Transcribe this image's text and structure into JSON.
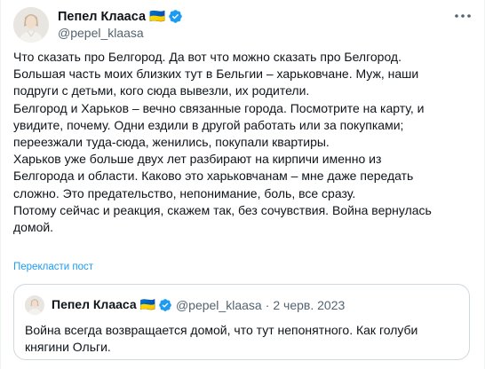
{
  "author": {
    "display_name": "Пепел Клааса 🇺🇦",
    "handle": "@pepel_klaasa",
    "verified": true,
    "avatar_icon": "profile-photo"
  },
  "tweet": {
    "lines": [
      "Что сказать про Белгород. Да вот что можно сказать про Белгород.",
      "Большая часть моих близких тут в Бельгии – харьковчане. Муж, наши",
      "подруги с детьми, кого сюда вывезли, их родители.",
      "Белгород и Харьков – вечно связанные города. Посмотрите на карту, и",
      "увидите, почему. Одни ездили в другой работать или за покупками;",
      "переезжали туда-сюда, женились, покупали квартиры.",
      "Харьков уже больше двух лет разбирают на кирпичи именно из",
      "Белгорода и области. Каково это харьковчанам – мне даже передать",
      "сложно. Это предательство, непонимание, боль, все сразу.",
      "Потому сейчас и реакция, скажем так, без сочувствия. Война вернулась",
      "домой."
    ],
    "translate_label": "Перекласти пост"
  },
  "quoted": {
    "display_name": "Пепел Клааса 🇺🇦",
    "handle": "@pepel_klaasa",
    "separator": "·",
    "date": "2 черв. 2023",
    "lines": [
      "Война всегда возвращается домой, что тут непонятного. Как голуби",
      "княгини Ольги."
    ]
  },
  "colors": {
    "accent": "#1d9bf0",
    "text": "#0f1419",
    "secondary": "#536471",
    "border": "#cfd9de"
  }
}
